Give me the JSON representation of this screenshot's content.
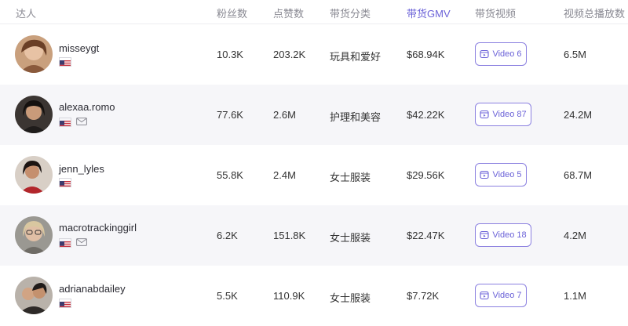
{
  "header": {
    "creator": "达人",
    "followers": "粉丝数",
    "likes": "点赞数",
    "category": "带货分类",
    "gmv": "带货GMV",
    "videos": "带货视频",
    "views": "视频总播放数"
  },
  "rows": [
    {
      "name": "misseygt",
      "followers": "10.3K",
      "likes": "203.2K",
      "category": "玩具和爱好",
      "gmv": "$68.94K",
      "video": "Video 6",
      "views": "6.5M"
    },
    {
      "name": "alexaa.romo",
      "followers": "77.6K",
      "likes": "2.6M",
      "category": "护理和美容",
      "gmv": "$42.22K",
      "video": "Video 87",
      "views": "24.2M"
    },
    {
      "name": "jenn_lyles",
      "followers": "55.8K",
      "likes": "2.4M",
      "category": "女士服装",
      "gmv": "$29.56K",
      "video": "Video 5",
      "views": "68.7M"
    },
    {
      "name": "macrotrackinggirl",
      "followers": "6.2K",
      "likes": "151.8K",
      "category": "女士服装",
      "gmv": "$22.47K",
      "video": "Video 18",
      "views": "4.2M"
    },
    {
      "name": "adrianabdailey",
      "followers": "5.5K",
      "likes": "110.9K",
      "category": "女士服装",
      "gmv": "$7.72K",
      "video": "Video 7",
      "views": "1.1M"
    }
  ],
  "colors": {
    "accent": "#6b62d8",
    "row_alt": "#f6f6f9",
    "header_text": "#8a8a93"
  },
  "icons": {
    "flag": "us-flag-icon",
    "mail": "mail-icon",
    "video": "video-icon"
  }
}
